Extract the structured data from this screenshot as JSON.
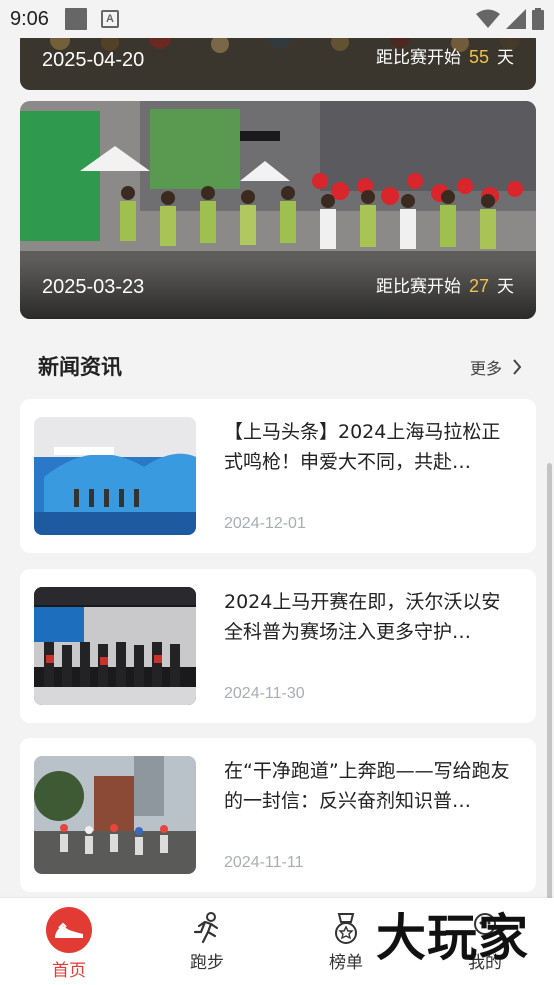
{
  "status_bar": {
    "time": "9:06",
    "icons": [
      "square-icon",
      "text-a-icon",
      "wifi-icon",
      "signal-icon",
      "battery-icon"
    ]
  },
  "races": [
    {
      "date": "2025-04-20",
      "countdown_prefix": "距比赛开始",
      "days": "55",
      "countdown_suffix": "天"
    },
    {
      "date": "2025-03-23",
      "countdown_prefix": "距比赛开始",
      "days": "27",
      "countdown_suffix": "天"
    }
  ],
  "news_section": {
    "title": "新闻资讯",
    "more_label": "更多"
  },
  "news": [
    {
      "title": "【上马头条】2024上海马拉松正式鸣枪！申爱大不同，共赴…",
      "date": "2024-12-01"
    },
    {
      "title": "2024上马开赛在即，沃尔沃以安全科普为赛场注入更多守护…",
      "date": "2024-11-30"
    },
    {
      "title": "在“干净跑道”上奔跑——写给跑友的一封信：反兴奋剂知识普…",
      "date": "2024-11-11"
    }
  ],
  "bottom_nav": [
    {
      "label": "首页",
      "icon": "shoe-icon",
      "active": true
    },
    {
      "label": "跑步",
      "icon": "runner-icon",
      "active": false
    },
    {
      "label": "榜单",
      "icon": "medal-icon",
      "active": false
    },
    {
      "label": "我的",
      "icon": "profile-icon",
      "active": false
    }
  ],
  "watermark": "大玩家",
  "colors": {
    "accent_red": "#e23b34",
    "countdown_days": "#f0c24a",
    "date_grey": "#a8adb5",
    "background": "#f3f3f4"
  }
}
